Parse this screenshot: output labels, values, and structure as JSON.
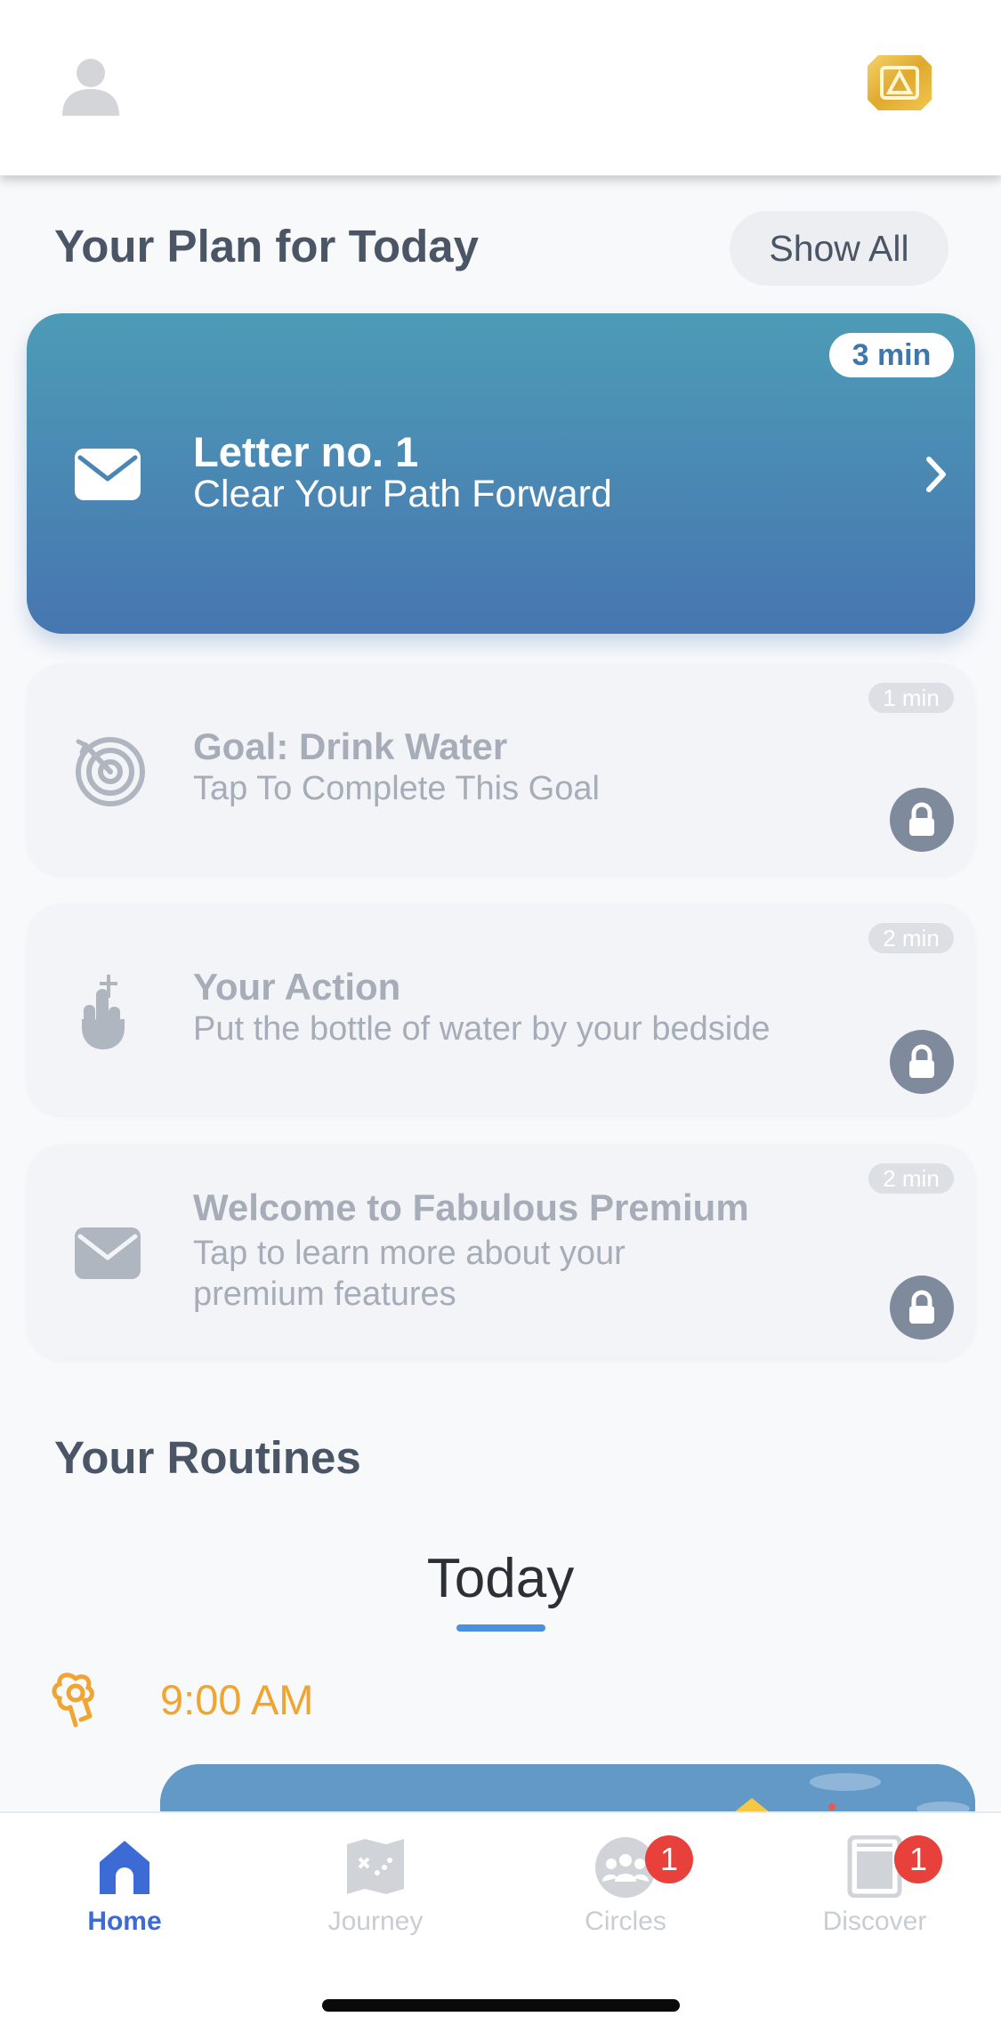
{
  "header": {
    "profile_icon": "person-icon",
    "premium_icon": "premium-gold-icon",
    "premium_color": "#e0a92e"
  },
  "plan": {
    "title": "Your Plan for Today",
    "show_all_label": "Show All",
    "cards": [
      {
        "title": "Letter no. 1",
        "subtitle": "Clear Your Path Forward",
        "duration": "3 min",
        "icon": "envelope-icon",
        "locked": false
      },
      {
        "title": "Goal: Drink Water",
        "subtitle": "Tap To Complete This Goal",
        "duration": "1 min",
        "icon": "target-icon",
        "locked": true
      },
      {
        "title": "Your Action",
        "subtitle": "Put the bottle of water by your bedside",
        "duration": "2 min",
        "icon": "hand-icon",
        "locked": true
      },
      {
        "title": "Welcome to Fabulous Premium",
        "subtitle": "Tap to learn more about your premium features",
        "duration": "2 min",
        "icon": "envelope-icon",
        "locked": true
      }
    ]
  },
  "routines": {
    "title": "Your Routines",
    "active_tab": "Today",
    "time": "9:00 AM",
    "time_icon": "sunrise-icon"
  },
  "nav": {
    "items": [
      {
        "label": "Home",
        "icon": "home-icon",
        "active": true
      },
      {
        "label": "Journey",
        "icon": "map-icon",
        "active": false
      },
      {
        "label": "Circles",
        "icon": "group-icon",
        "active": false,
        "badge": "1"
      },
      {
        "label": "Discover",
        "icon": "book-icon",
        "active": false,
        "badge": "1"
      }
    ]
  },
  "colors": {
    "accent_blue": "#3c6bd5",
    "card_gradient_top": "#4d9bb7",
    "card_gradient_bottom": "#4776b0",
    "routine_time": "#f0a533",
    "badge_red": "#e8403b"
  }
}
